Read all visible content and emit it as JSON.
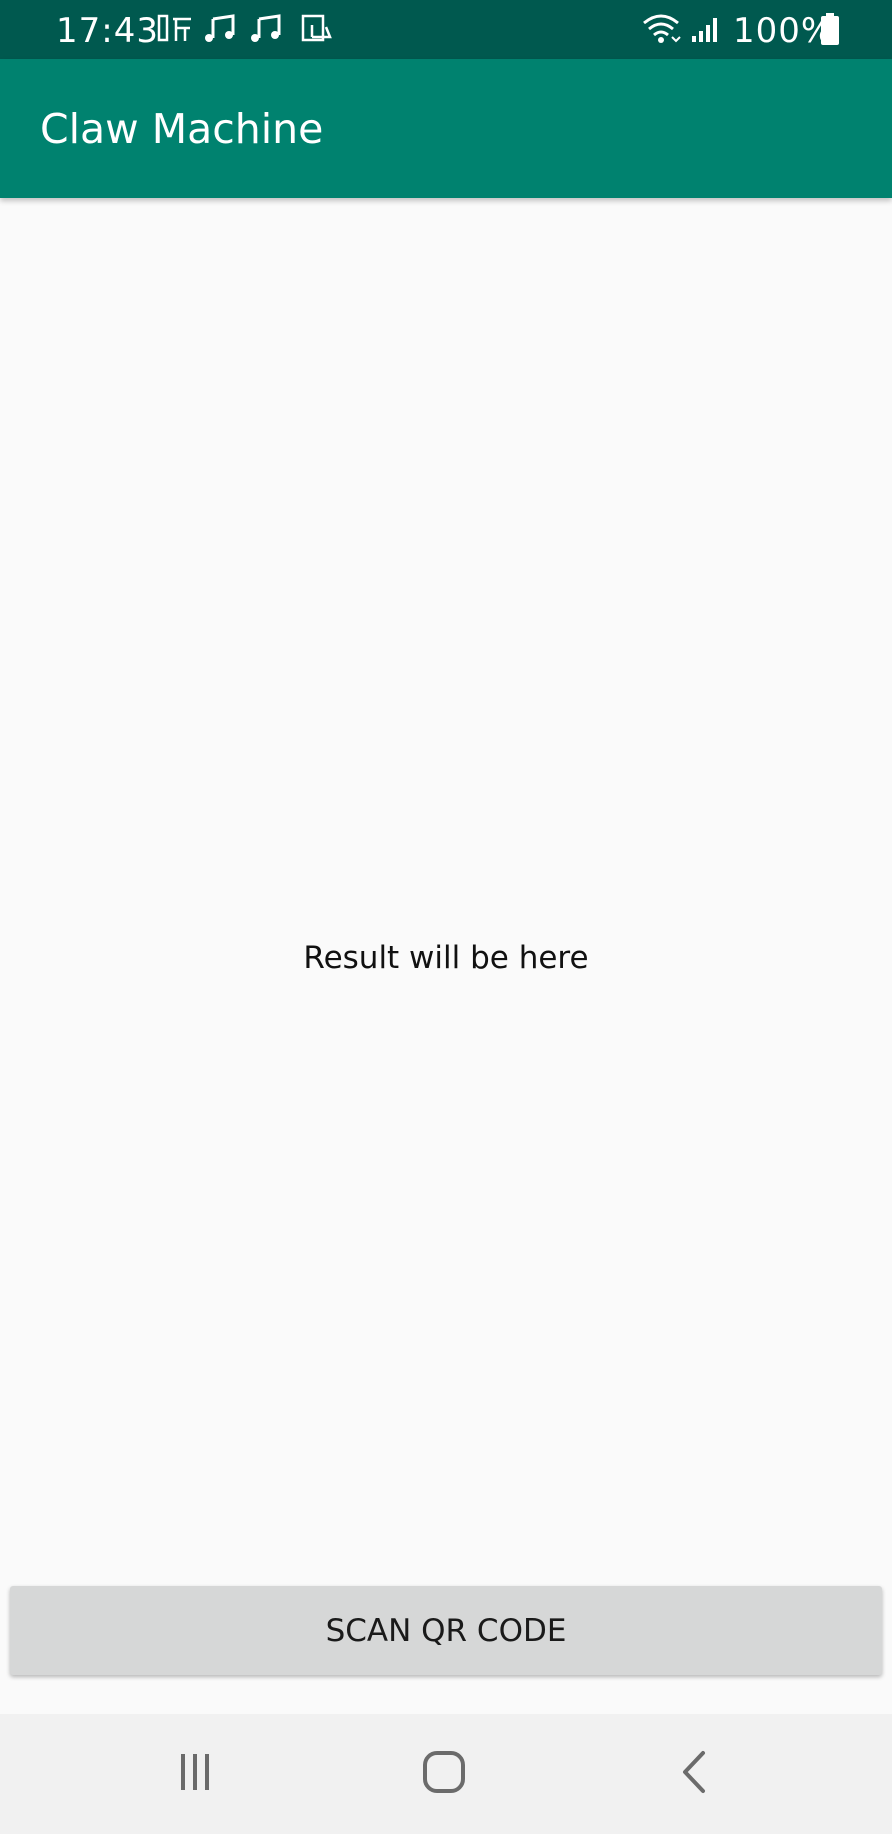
{
  "status_bar": {
    "time": "17:43",
    "battery": "100%",
    "icons": [
      "notification-app-icon",
      "music-note-icon",
      "music-note-icon",
      "screenshot-icon",
      "wifi-icon",
      "signal-icon",
      "battery-icon"
    ]
  },
  "app_bar": {
    "title": "Claw Machine"
  },
  "main": {
    "result_text": "Result will be here",
    "scan_button_label": "SCAN QR CODE"
  },
  "navigation": {
    "items": [
      "recent-apps-icon",
      "home-icon",
      "back-icon"
    ]
  },
  "colors": {
    "status_bar": "#00594f",
    "app_bar": "#00826f",
    "background": "#fafafa",
    "button": "#d6d7d7"
  }
}
